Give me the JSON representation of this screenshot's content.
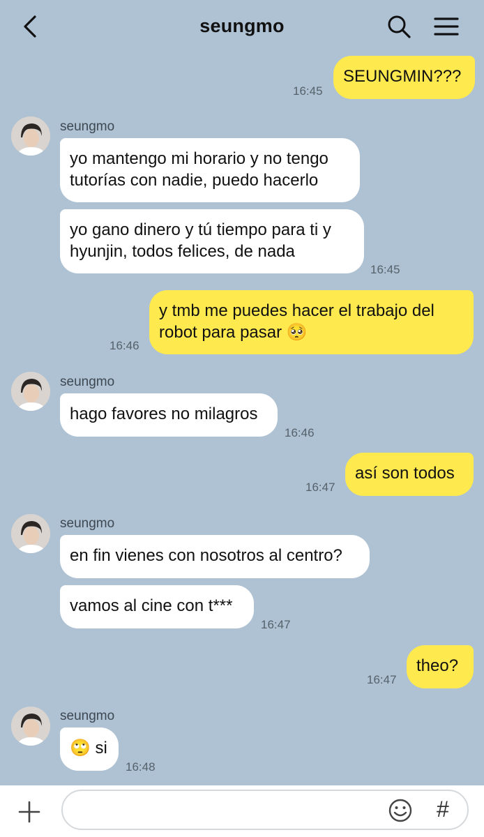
{
  "header": {
    "title": "seungmo"
  },
  "icons": {
    "back": "chevron-left-icon",
    "search": "search-icon",
    "menu": "hamburger-menu-icon",
    "add": "plus-icon",
    "emoji": "smiley-icon",
    "hashtag": "hashtag-icon"
  },
  "contact": {
    "name": "seungmo"
  },
  "messages": [
    {
      "from": "me",
      "text": "SEUNGMIN???",
      "time": "16:45"
    },
    {
      "from": "them",
      "text_lines": [
        "yo mantengo mi horario y no tengo",
        "tutorías con nadie, puedo hacerlo"
      ]
    },
    {
      "from": "them",
      "text_lines": [
        "yo gano dinero y tú tiempo para ti y",
        "hyunjin, todos felices, de nada"
      ],
      "time": "16:45"
    },
    {
      "from": "me",
      "text_lines": [
        "y tmb me puedes hacer el trabajo del",
        "robot para pasar 🥺"
      ],
      "time": "16:46"
    },
    {
      "from": "them",
      "text": "hago favores no milagros",
      "time": "16:46"
    },
    {
      "from": "me",
      "text": "así son todos",
      "time": "16:47"
    },
    {
      "from": "them",
      "text": "en fin vienes con nosotros al centro?"
    },
    {
      "from": "them",
      "text": "vamos al cine con t***",
      "time": "16:47"
    },
    {
      "from": "me",
      "text": "theo?",
      "time": "16:47"
    },
    {
      "from": "them",
      "text": "🙄 si",
      "time": "16:48"
    }
  ],
  "composer": {
    "value": "",
    "hashtag_label": "#"
  },
  "colors": {
    "background": "#afc2d3",
    "my_bubble": "#fee94e",
    "their_bubble": "#ffffff"
  }
}
